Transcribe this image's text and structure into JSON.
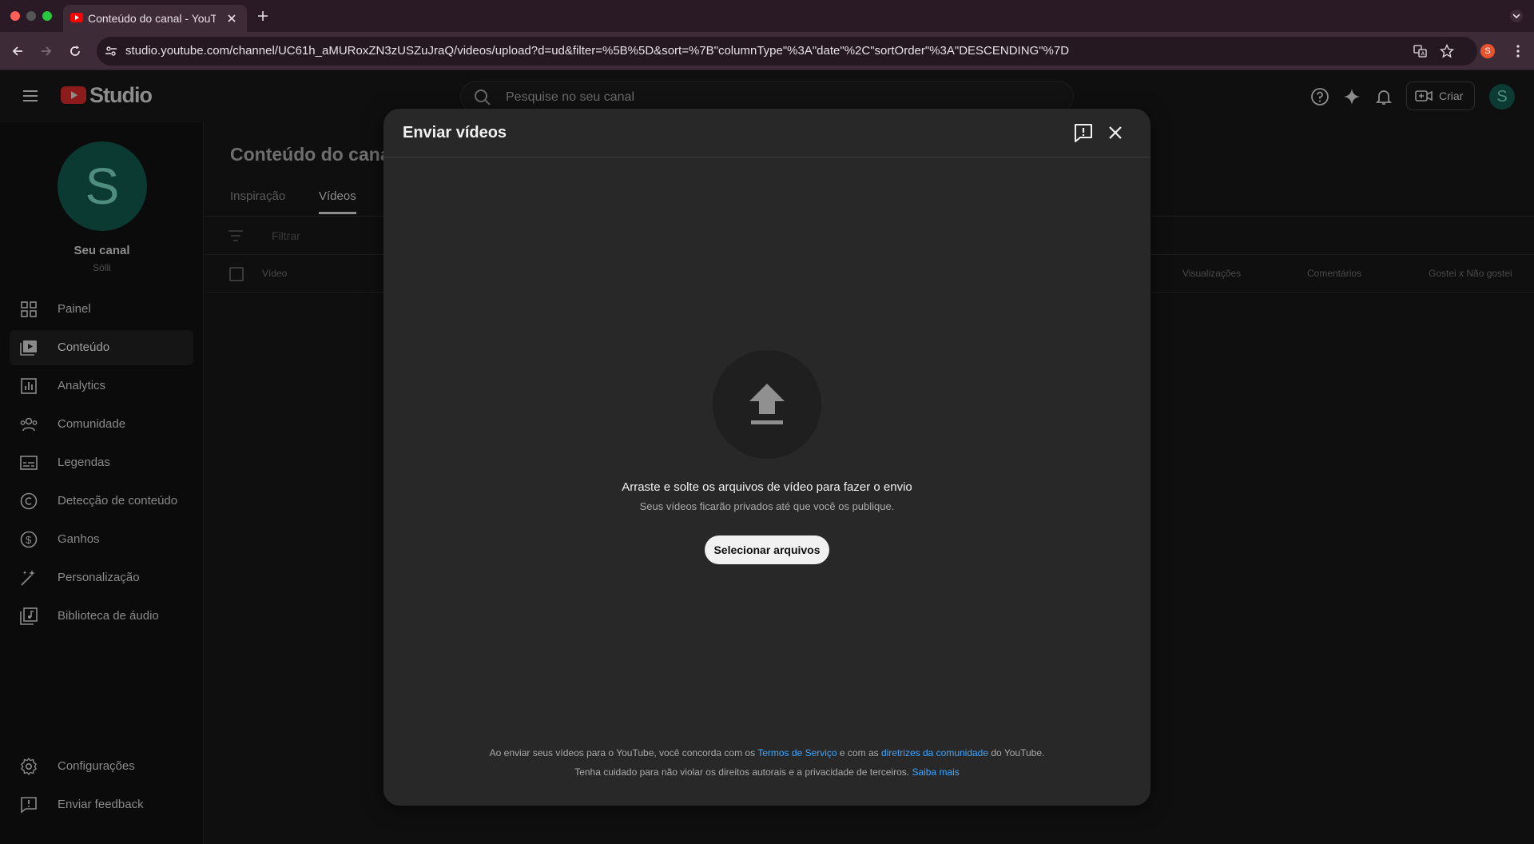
{
  "browser": {
    "tab_title": "Conteúdo do canal - YouTube Studio",
    "url": "studio.youtube.com/channel/UC61h_aMURoxZN3zUSZuJraQ/videos/upload?d=ud&filter=%5B%5D&sort=%7B\"columnType\"%3A\"date\"%2C\"sortOrder\"%3A\"DESCENDING\"%7D",
    "profile_initial": "S"
  },
  "header": {
    "logo_text": "Studio",
    "search_placeholder": "Pesquise no seu canal",
    "create_label": "Criar",
    "avatar_initial": "S"
  },
  "sidebar": {
    "avatar_initial": "S",
    "channel_title": "Seu canal",
    "channel_name": "Sólli",
    "items": [
      {
        "label": "Painel",
        "icon": "dashboard-icon"
      },
      {
        "label": "Conteúdo",
        "icon": "content-icon",
        "active": true
      },
      {
        "label": "Analytics",
        "icon": "analytics-icon"
      },
      {
        "label": "Comunidade",
        "icon": "community-icon"
      },
      {
        "label": "Legendas",
        "icon": "subtitles-icon"
      },
      {
        "label": "Detecção de conteúdo",
        "icon": "copyright-icon"
      },
      {
        "label": "Ganhos",
        "icon": "earn-icon"
      },
      {
        "label": "Personalização",
        "icon": "customization-icon"
      },
      {
        "label": "Biblioteca de áudio",
        "icon": "audio-library-icon"
      }
    ],
    "bottom_items": [
      {
        "label": "Configurações",
        "icon": "settings-icon"
      },
      {
        "label": "Enviar feedback",
        "icon": "feedback-icon"
      }
    ]
  },
  "main": {
    "title": "Conteúdo do canal",
    "tabs": [
      "Inspiração",
      "Vídeos"
    ],
    "filter_placeholder": "Filtrar",
    "columns": [
      "Vídeo",
      "Visualizações",
      "Comentários",
      "Gostei x Não gostei"
    ]
  },
  "modal": {
    "title": "Enviar vídeos",
    "drop_title": "Arraste e solte os arquivos de vídeo para fazer o envio",
    "drop_subtitle": "Seus vídeos ficarão privados até que você os publique.",
    "select_button": "Selecionar arquivos",
    "legal_1_prefix": "Ao enviar seus vídeos para o YouTube, você concorda com os ",
    "legal_1_link1": "Termos de Serviço",
    "legal_1_mid": " e com as ",
    "legal_1_link2": "diretrizes da comunidade",
    "legal_1_suffix": " do YouTube.",
    "legal_2_prefix": "Tenha cuidado para não violar os direitos autorais e a privacidade de terceiros. ",
    "legal_2_link": "Saiba mais"
  },
  "colors": {
    "accent_link": "#3ea6ff",
    "youtube_red": "#ff0000",
    "modal_bg": "#282828"
  }
}
